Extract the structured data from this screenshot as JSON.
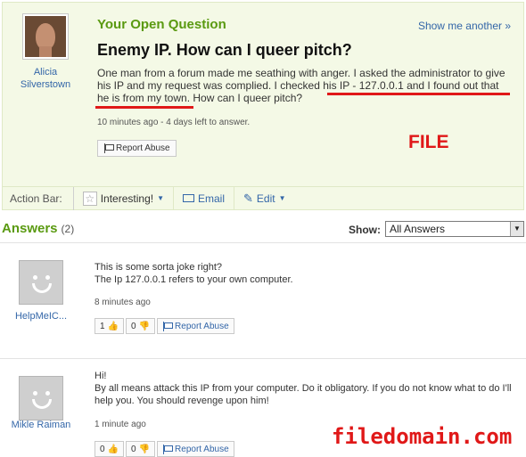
{
  "question": {
    "kicker": "Your Open Question",
    "show_another": "Show me another »",
    "asker_name": "Alicia Silverstown",
    "title": "Enemy IP. How can I queer pitch?",
    "body": "One man from a forum made me seathing with anger. I asked the administrator to give his IP and my request was complied. I checked his IP - 127.0.0.1 and I found out that he is from my town. How can I queer pitch?",
    "meta": "10 minutes ago - 4 days left to answer.",
    "report": "Report Abuse"
  },
  "stamp": "FILE",
  "action_bar": {
    "label": "Action Bar:",
    "interesting": "Interesting!",
    "email": "Email",
    "edit": "Edit"
  },
  "answers_header": {
    "title": "Answers",
    "count": "(2)",
    "show_label": "Show:",
    "filter": "All Answers"
  },
  "answers": [
    {
      "name": "HelpMeIC...",
      "lines": [
        "This is some sorta joke right?",
        "The Ip 127.0.0.1 refers to your own computer."
      ],
      "meta": "8 minutes ago",
      "thumbs_up": "1",
      "thumbs_down": "0",
      "report": "Report Abuse"
    },
    {
      "name": "Mikle Raiman",
      "lines": [
        "Hi!",
        "By all means attack this IP from your computer. Do it obligatory. If you do not know what to do I'll help you. You should revenge upon him!"
      ],
      "meta": "1 minute ago",
      "thumbs_up": "0",
      "thumbs_down": "0",
      "report": "Report Abuse"
    }
  ],
  "watermark": "filedomain.com",
  "colors": {
    "accent_green": "#5a9a11",
    "link_blue": "#3366a8",
    "highlight_red": "#e01818"
  },
  "icons": [
    "flag-icon",
    "star-icon",
    "caret-down-icon",
    "email-icon",
    "pencil-icon",
    "thumbs-up-icon",
    "thumbs-down-icon"
  ]
}
